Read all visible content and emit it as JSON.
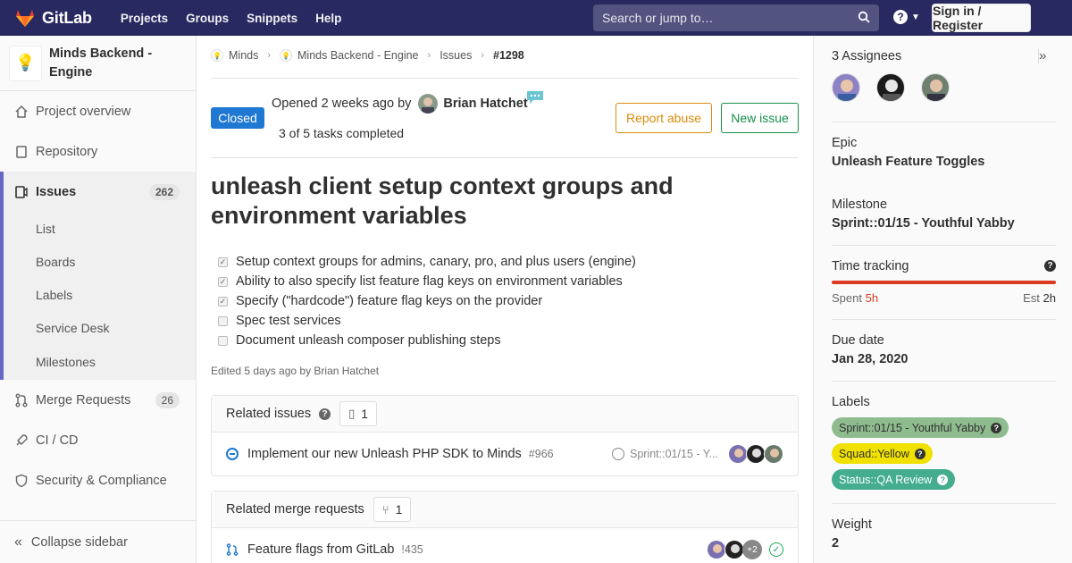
{
  "navbar": {
    "brand": "GitLab",
    "links": [
      "Projects",
      "Groups",
      "Snippets",
      "Help"
    ],
    "search_placeholder": "Search or jump to…",
    "help_icon": "?",
    "signin_label": "Sign in / Register"
  },
  "sidebar": {
    "project_name": "Minds Backend - Engine",
    "items": [
      {
        "label": "Project overview",
        "icon": "home-icon"
      },
      {
        "label": "Repository",
        "icon": "doc-icon"
      }
    ],
    "issues": {
      "label": "Issues",
      "count": "262"
    },
    "issue_subitems": [
      "List",
      "Boards",
      "Labels",
      "Service Desk",
      "Milestones"
    ],
    "more_items": [
      {
        "label": "Merge Requests",
        "count": "26"
      },
      {
        "label": "CI / CD"
      },
      {
        "label": "Security & Compliance"
      }
    ],
    "collapse_label": "Collapse sidebar"
  },
  "breadcrumb": {
    "items": [
      "Minds",
      "Minds Backend - Engine",
      "Issues"
    ],
    "current": "#1298"
  },
  "issue": {
    "status": "Closed",
    "opened_text": "Opened 2 weeks ago by",
    "author": "Brian Hatchet",
    "tasks_summary": "3 of 5 tasks completed",
    "report_label": "Report abuse",
    "new_issue_label": "New issue",
    "title": "unleash client setup context groups and environment variables",
    "tasks": [
      {
        "text": "Setup context groups for admins, canary, pro, and plus users (engine)",
        "done": true
      },
      {
        "text": "Ability to also specify list feature flag keys on environment variables",
        "done": true
      },
      {
        "text": "Specify (\"hardcode\") feature flag keys on the provider",
        "done": true
      },
      {
        "text": "Spec test services",
        "done": false
      },
      {
        "text": "Document unleash composer publishing steps",
        "done": false
      }
    ],
    "edited_text": "Edited 5 days ago by Brian Hatchet"
  },
  "related_issues": {
    "title": "Related issues",
    "count": "1",
    "item_title": "Implement our new Unleash PHP SDK to Minds",
    "item_ref": "#966",
    "item_milestone": "Sprint::01/15 - Y..."
  },
  "related_mrs": {
    "title": "Related merge requests",
    "count": "1",
    "item_title": "Feature flags from GitLab",
    "item_ref": "!435",
    "extra_avatars": "+2"
  },
  "right_sidebar": {
    "assignees_label": "3 Assignees",
    "epic_label": "Epic",
    "epic_value": "Unleash Feature Toggles",
    "milestone_label": "Milestone",
    "milestone_value": "Sprint::01/15 - Youthful Yabby",
    "time_label": "Time tracking",
    "spent_label": "Spent",
    "spent_value": "5h",
    "est_label": "Est",
    "est_value": "2h",
    "due_label": "Due date",
    "due_value": "Jan 28, 2020",
    "labels_label": "Labels",
    "labels": [
      {
        "text": "Sprint::01/15 - Youthful Yabby",
        "color": "#8fbc8f"
      },
      {
        "text": "Squad::Yellow",
        "color": "#f0e100"
      },
      {
        "text": "Status::QA Review",
        "color": "#44ad8e"
      }
    ],
    "weight_label": "Weight",
    "weight_value": "2"
  },
  "colors": {
    "navbar": "#292961",
    "closed": "#1f78d1",
    "abuse": "#db8b0b",
    "new_issue": "#168f48",
    "overspent": "#db3b21"
  }
}
